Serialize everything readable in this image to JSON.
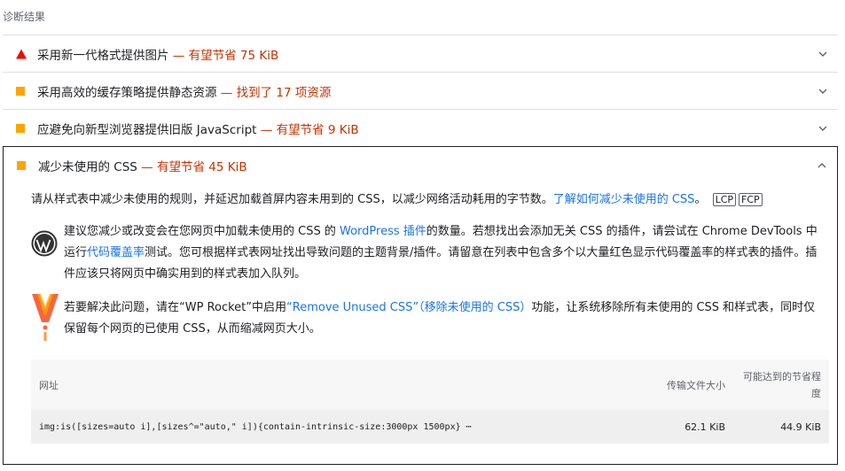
{
  "section_title": "诊断结果",
  "audits": [
    {
      "title": "采用新一代格式提供图片",
      "sep": "—",
      "display": "有望节省 75 KiB",
      "severity": "fail"
    },
    {
      "title": "采用高效的缓存策略提供静态资源",
      "sep": "—",
      "display": "找到了 17 项资源",
      "severity": "average"
    },
    {
      "title": "应避免向新型浏览器提供旧版 JavaScript",
      "sep": "—",
      "display": "有望节省 9 KiB",
      "severity": "average"
    },
    {
      "title": "减少未使用的 CSS",
      "sep": "—",
      "display": "有望节省 45 KiB",
      "severity": "average"
    }
  ],
  "expanded": {
    "desc_text": "请从样式表中减少未使用的规则，并延迟加载首屏内容未用到的 CSS，以减少网络活动耗用的字节数。",
    "desc_link": "了解如何减少未使用的 CSS",
    "desc_end": "。",
    "chips": [
      "LCP",
      "FCP"
    ],
    "wordpress": {
      "t1": "建议您减少或改变会在您网页中加载未使用的 CSS 的 ",
      "link1": "WordPress 插件",
      "t2": "的数量。若想找出会添加无关 CSS 的插件，请尝试在 Chrome DevTools 中运行",
      "link2": "代码覆盖率",
      "t3": "测试。您可根据样式表网址找出导致问题的主题背景/插件。请留意在列表中包含多个以大量红色显示代码覆盖率的样式表的插件。插件应该只将网页中确实用到的样式表加入队列。"
    },
    "wprocket": {
      "t1": "若要解决此问题，请在“WP Rocket”中启用",
      "link1": "“Remove Unused CSS”（移除未使用的 CSS）",
      "t2": "功能，让系统移除所有未使用的 CSS 和样式表，同时仅保留每个网页的已使用 CSS，从而缩减网页大小。"
    },
    "table": {
      "headers": {
        "url": "网址",
        "transfer": "传输文件大小",
        "savings": "可能达到的节省程度"
      },
      "rows": [
        {
          "url": "img:is([sizes=auto i],[sizes^=\"auto,\" i]){contain-intrinsic-size:3000px 1500px} ⋯",
          "transfer": "62.1 KiB",
          "savings": "44.9 KiB"
        }
      ]
    }
  },
  "colors": {
    "fail": "#eb0f00",
    "average": "#ffa400",
    "link": "#1a73e8",
    "display": "#c33300"
  },
  "icons": [
    "fail-triangle-icon",
    "average-square-icon",
    "chevron-down-icon",
    "chevron-up-icon",
    "wordpress-logo-icon",
    "wp-rocket-logo-icon"
  ]
}
